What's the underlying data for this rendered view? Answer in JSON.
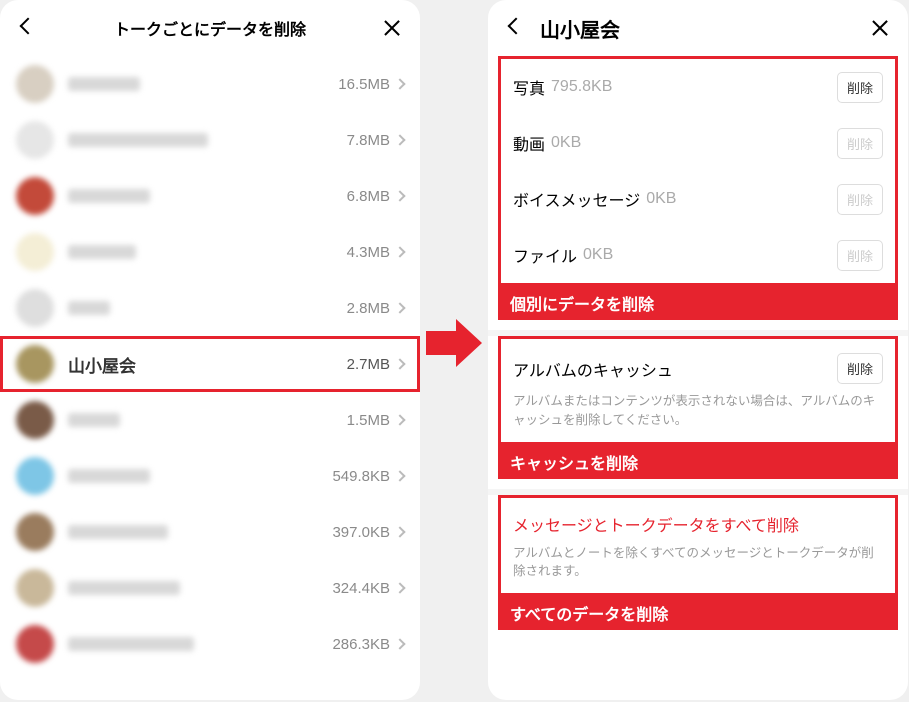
{
  "leftPhone": {
    "title": "トークごとにデータを削除",
    "rows": [
      {
        "name": null,
        "size": "16.5MB",
        "avatar": "#d8cfc2",
        "highlight": false,
        "nameWidth": 72
      },
      {
        "name": null,
        "size": "7.8MB",
        "avatar": "#e6e6e6",
        "highlight": false,
        "nameWidth": 140
      },
      {
        "name": null,
        "size": "6.8MB",
        "avatar": "#c34a3a",
        "highlight": false,
        "nameWidth": 82
      },
      {
        "name": null,
        "size": "4.3MB",
        "avatar": "#f4eed6",
        "highlight": false,
        "nameWidth": 68
      },
      {
        "name": null,
        "size": "2.8MB",
        "avatar": "#dedede",
        "highlight": false,
        "nameWidth": 42
      },
      {
        "name": "山小屋会",
        "size": "2.7MB",
        "avatar": "#a89660",
        "highlight": true,
        "nameWidth": 0
      },
      {
        "name": null,
        "size": "1.5MB",
        "avatar": "#7a5b48",
        "highlight": false,
        "nameWidth": 52
      },
      {
        "name": null,
        "size": "549.8KB",
        "avatar": "#7ec6e6",
        "highlight": false,
        "nameWidth": 82
      },
      {
        "name": null,
        "size": "397.0KB",
        "avatar": "#9a7c5e",
        "highlight": false,
        "nameWidth": 100
      },
      {
        "name": null,
        "size": "324.4KB",
        "avatar": "#c9b89a",
        "highlight": false,
        "nameWidth": 112
      },
      {
        "name": null,
        "size": "286.3KB",
        "avatar": "#c54a4a",
        "highlight": false,
        "nameWidth": 126
      }
    ]
  },
  "rightPhone": {
    "title": "山小屋会",
    "dataRows": [
      {
        "label": "写真",
        "size": "795.8KB",
        "btn": "削除",
        "enabled": true
      },
      {
        "label": "動画",
        "size": "0KB",
        "btn": "削除",
        "enabled": false
      },
      {
        "label": "ボイスメッセージ",
        "size": "0KB",
        "btn": "削除",
        "enabled": false
      },
      {
        "label": "ファイル",
        "size": "0KB",
        "btn": "削除",
        "enabled": false
      }
    ],
    "caption1": "個別にデータを削除",
    "albumSection": {
      "title": "アルバムのキャッシュ",
      "btn": "削除",
      "desc": "アルバムまたはコンテンツが表示されない場合は、アルバムのキャッシュを削除してください。"
    },
    "caption2": "キャッシュを削除",
    "deleteAll": {
      "title": "メッセージとトークデータをすべて削除",
      "desc": "アルバムとノートを除くすべてのメッセージとトークデータが削除されます。"
    },
    "caption3": "すべてのデータを削除"
  }
}
